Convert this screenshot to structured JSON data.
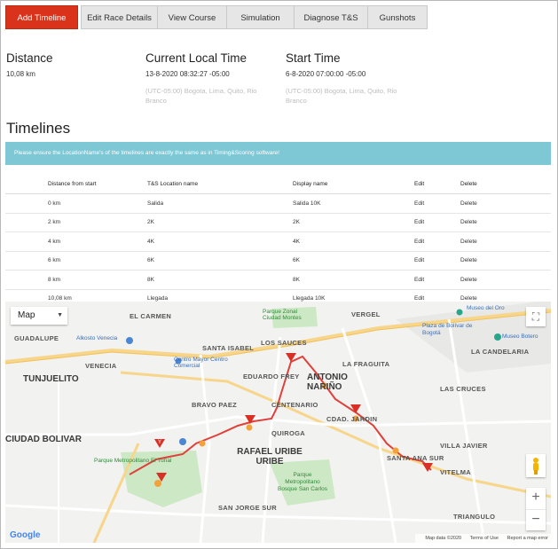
{
  "tabs": [
    {
      "label": "Add Timeline",
      "active": true
    },
    {
      "label": "Edit Race Details",
      "active": false
    },
    {
      "label": "View Course",
      "active": false
    },
    {
      "label": "Simulation",
      "active": false
    },
    {
      "label": "Diagnose T&S",
      "active": false
    },
    {
      "label": "Gunshots",
      "active": false
    }
  ],
  "info": {
    "distance": {
      "label": "Distance",
      "value": "10,08 km"
    },
    "current_time": {
      "label": "Current Local Time",
      "value": "13-8-2020 08:32:27 -05:00",
      "timezone": "(UTC-05:00) Bogota, Lima, Quito, Rio Branco"
    },
    "start_time": {
      "label": "Start Time",
      "value": "6-8-2020 07:00:00 -05:00",
      "timezone": "(UTC-05:00) Bogota, Lima, Quito, Rio Branco"
    }
  },
  "timelines": {
    "title": "Timelines",
    "alert": "Please ensure the LocationName's of the timelines are exactly the same as in Timing&Scoring software!",
    "columns": [
      "Distance from start",
      "T&S Location name",
      "Display name",
      "Edit",
      "Delete"
    ],
    "rows": [
      {
        "distance": "0 km",
        "location": "Salida",
        "display": "Salida 10K",
        "edit": "Edit",
        "delete": "Delete"
      },
      {
        "distance": "2 km",
        "location": "2K",
        "display": "2K",
        "edit": "Edit",
        "delete": "Delete"
      },
      {
        "distance": "4 km",
        "location": "4K",
        "display": "4K",
        "edit": "Edit",
        "delete": "Delete"
      },
      {
        "distance": "6 km",
        "location": "6K",
        "display": "6K",
        "edit": "Edit",
        "delete": "Delete"
      },
      {
        "distance": "8 km",
        "location": "8K",
        "display": "8K",
        "edit": "Edit",
        "delete": "Delete"
      },
      {
        "distance": "10,08 km",
        "location": "Llegada",
        "display": "Llegada 10K",
        "edit": "Edit",
        "delete": "Delete"
      }
    ]
  },
  "map": {
    "type_label": "Map",
    "google": "Google",
    "attribution": [
      "Map data ©2020",
      "Terms of Use",
      "Report a map error"
    ],
    "zoom_in": "+",
    "zoom_out": "−",
    "route_color": "#e0403c",
    "labels": [
      {
        "text": "EL CARMEN",
        "cls": "med"
      },
      {
        "text": "Parque Zonal Ciudad Montes",
        "cls": "green"
      },
      {
        "text": "Museo del Oro",
        "cls": "blue"
      },
      {
        "text": "GUADALUPE",
        "cls": "med"
      },
      {
        "text": "Alkosto Venecia",
        "cls": "blue"
      },
      {
        "text": "LOS SAUCES",
        "cls": "med"
      },
      {
        "text": "VERGEL",
        "cls": "med"
      },
      {
        "text": "LA CANDELARIA",
        "cls": "med"
      },
      {
        "text": "VENECIA",
        "cls": "med"
      },
      {
        "text": "Centro Mayor Centro Comercial",
        "cls": "blue"
      },
      {
        "text": "SANTA ISABEL",
        "cls": "med"
      },
      {
        "text": "LA FRAGUITA",
        "cls": "med"
      },
      {
        "text": "TUNJUELITO",
        "cls": "big"
      },
      {
        "text": "ANTONIO NARIÑO",
        "cls": "big"
      },
      {
        "text": "EDUARDO FREY",
        "cls": "med"
      },
      {
        "text": "LAS CRUCES",
        "cls": "med"
      },
      {
        "text": "CENTENARIO",
        "cls": "med"
      },
      {
        "text": "CDAD. JARDIN",
        "cls": "med"
      },
      {
        "text": "BRAVO PAEZ",
        "cls": "med"
      },
      {
        "text": "CIUDAD BOLIVAR",
        "cls": "big"
      },
      {
        "text": "QUIROGA",
        "cls": "med"
      },
      {
        "text": "VILLA JAVIER",
        "cls": "med"
      },
      {
        "text": "RAFAEL URIBE URIBE",
        "cls": "big"
      },
      {
        "text": "SANTA ANA SUR",
        "cls": "med"
      },
      {
        "text": "Parque Metropolitano El Tunal",
        "cls": "green"
      },
      {
        "text": "Parque Metropolitano Bosque San Carlos",
        "cls": "green"
      },
      {
        "text": "VITELMA",
        "cls": "med"
      },
      {
        "text": "SAN JORGE SUR",
        "cls": "med"
      },
      {
        "text": "TRIANGULO",
        "cls": "med"
      },
      {
        "text": "Plaza de Bolívar de Bogotá",
        "cls": "blue"
      },
      {
        "text": "Museo Botero",
        "cls": "blue"
      }
    ]
  }
}
